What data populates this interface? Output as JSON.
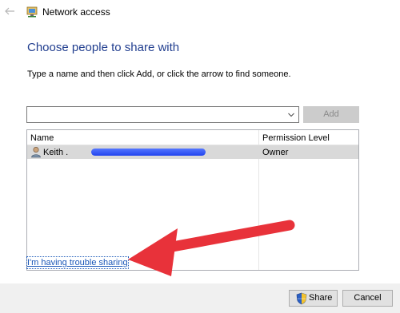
{
  "window": {
    "title": "Network access"
  },
  "main": {
    "heading": "Choose people to share with",
    "instructions": "Type a name and then click Add, or click the arrow to find someone.",
    "add_label": "Add"
  },
  "list": {
    "columns": [
      "Name",
      "Permission Level"
    ],
    "rows": [
      {
        "name": "Keith .",
        "permission": "Owner"
      }
    ]
  },
  "trouble_link": "I'm having trouble sharing",
  "footer": {
    "share_label": "Share",
    "cancel_label": "Cancel"
  },
  "colors": {
    "heading": "#213e8f",
    "link": "#1b57b8",
    "annotation_arrow": "#e8323a",
    "redaction": "#2f4ff0"
  },
  "icons": {
    "back": "back-arrow-icon",
    "network": "network-share-icon",
    "user": "user-icon",
    "shield": "uac-shield-icon",
    "dropdown": "chevron-down-icon"
  }
}
